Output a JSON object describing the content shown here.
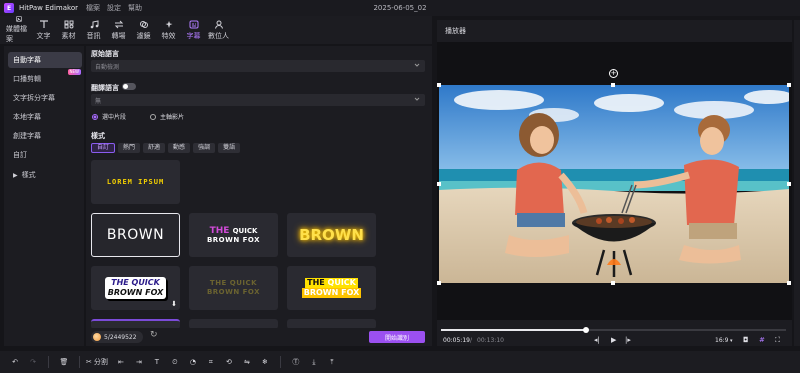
{
  "app": {
    "name": "HitPaw Edimakor",
    "doc_title": "2025-06-05_02"
  },
  "menu": [
    "檔案",
    "設定",
    "幫助"
  ],
  "toolbar": [
    {
      "label": "媒體檔案",
      "icon": "media-icon"
    },
    {
      "label": "文字",
      "icon": "text-icon"
    },
    {
      "label": "素材",
      "icon": "materials-icon"
    },
    {
      "label": "音訊",
      "icon": "audio-icon"
    },
    {
      "label": "轉場",
      "icon": "transition-icon"
    },
    {
      "label": "濾鏡",
      "icon": "filter-icon"
    },
    {
      "label": "特效",
      "icon": "effects-icon"
    },
    {
      "label": "字幕",
      "icon": "subtitle-icon",
      "active": true
    },
    {
      "label": "數位人",
      "icon": "avatar-icon"
    }
  ],
  "sidebar": {
    "items": [
      {
        "label": "自動字幕",
        "active": true
      },
      {
        "label": "口播剪輯",
        "badge": "NEW"
      },
      {
        "label": "文字拆分字幕"
      },
      {
        "label": "本地字幕"
      },
      {
        "label": "創建字幕"
      },
      {
        "label": "自訂"
      },
      {
        "label": "樣式",
        "expandable": true
      }
    ]
  },
  "panel": {
    "source_lang_label": "原始語言",
    "source_lang_value": "自動檢測",
    "translate_label": "翻譯語言",
    "translate_toggle": false,
    "translate_value": "無",
    "radio_selected": "選中片段",
    "radio_other": "主軸影片",
    "style_label": "樣式",
    "chips": [
      "自訂",
      "熱門",
      "舒適",
      "動感",
      "強調",
      "雙語"
    ],
    "presets": [
      {
        "text": "LOREM IPSUM"
      },
      {
        "text": "BROWN"
      },
      {
        "text_line1": "THE",
        "text_line1b": "QUICK",
        "text_line2": "BROWN FOX"
      },
      {
        "text": "BROWN"
      },
      {
        "text_line1": "THE QUICK",
        "text_line2": "BROWN FOX"
      },
      {
        "text_line1": "THE QUICK",
        "text_line2": "BROWN FOX"
      },
      {
        "text_line1": "THE",
        "text_line1b": "QUICK",
        "text_line2": "BROWN FOX"
      }
    ],
    "credits": "5/2449522",
    "start_button": "開始識別"
  },
  "player": {
    "title": "播放器",
    "current_time": "00:05:19",
    "separator": "/",
    "total_time": "00:13:10",
    "aspect": "16:9",
    "progress": 0.42
  },
  "timeline_toolbar": {
    "split_label": "分割"
  },
  "colors": {
    "accent": "#9b50f0",
    "accent_text": "#b17bff",
    "panel_bg": "#1c1c21",
    "app_bg": "#151519"
  }
}
